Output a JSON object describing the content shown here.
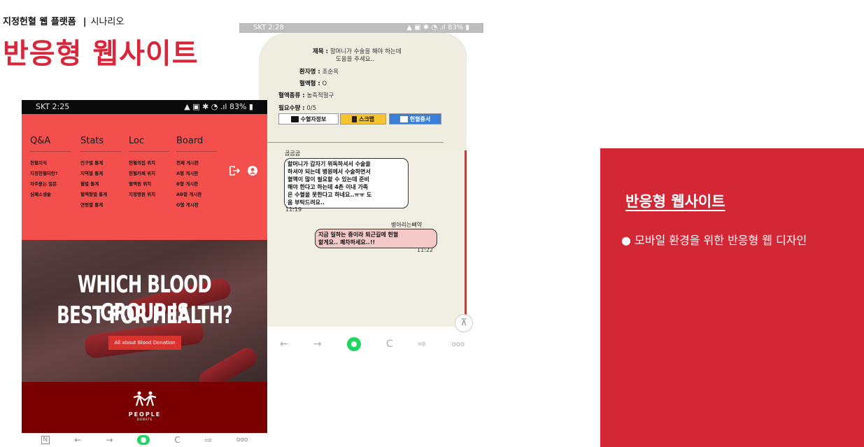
{
  "slide": {
    "header_label": "지정헌혈 웹 플랫폼",
    "header_separator": "|",
    "header_sub": "시나리오",
    "title": "반응형 웹사이트"
  },
  "phone1": {
    "status_time": "SKT 2:25",
    "status_right": "83%",
    "nav": [
      {
        "head": "Q&A",
        "items": [
          "헌혈지식",
          "지정헌혈이란?",
          "자주묻는 질문",
          "심폐소생술"
        ]
      },
      {
        "head": "Stats",
        "items": [
          "인구별 통계",
          "지역별 통계",
          "월별 통계",
          "혈액형별 통계",
          "연령별 통계"
        ]
      },
      {
        "head": "Loc",
        "items": [
          "헌혈의집 위치",
          "헌혈카페 위치",
          "혈액원 위치",
          "지정병원 위치"
        ]
      },
      {
        "head": "Board",
        "items": [
          "전체 게시판",
          "A형 게시판",
          "B형 게시판",
          "AB형 게시판",
          "O형 게시판"
        ]
      }
    ],
    "hero_line1": "WHICH BLOOD GROUP IS",
    "hero_line2": "BEST FOR HEALTH?",
    "hero_button": "All about Blood Donation",
    "logo_text": "PEOPLE",
    "logo_sub": "DONATE",
    "bottom_bar": [
      "N",
      "←",
      "→",
      "",
      "C",
      "⇨",
      "ooo"
    ]
  },
  "phone2": {
    "status_time": "SKT 2:28",
    "status_right": "83%",
    "info": {
      "title_key": "제목 :",
      "title_val_1": "할머니가 수술을 해야 하는데",
      "title_val_2": "도움을 주세요..",
      "patient_key": "환자명 :",
      "patient_val": "조순옥",
      "blood_key": "혈액형 :",
      "blood_val": "O",
      "type_key": "혈액종류 :",
      "type_val": "농축적혈구",
      "need_key": "필요수량 :",
      "need_val": "0/5"
    },
    "buttons": {
      "donor_info": "수혈자정보",
      "scrap": "스크랩",
      "certificate": "헌혈증서"
    },
    "comments": [
      {
        "name": "곰곰곰",
        "lines": [
          "할머니가 갑자기 위독하셔서 수술을",
          "하셔야 되는데 병원에서 수술하면서",
          "혈액이 많이 필요할 수 있는데 준비",
          "해야 한다고 하는데 4촌 이내 가족",
          "은 수혈을 못한다고 하네요..ㅠㅠ 도",
          "움 부탁드려요.."
        ],
        "time": "11:19"
      },
      {
        "name": "병아리는삐약",
        "lines": [
          "지금 일하는 중이라 퇴근길에 헌혈",
          "할게요.. 쾌차하세요..!!"
        ],
        "time": "11:22"
      }
    ],
    "top_button": "⊼",
    "bottom_bar": [
      "←",
      "→",
      "",
      "C",
      "⇨",
      "ooo"
    ]
  },
  "panel": {
    "title": "반응형 웹사이트",
    "bullet": "● 모바일 환경을 위한 반응형 웹 디자인"
  },
  "colors": {
    "brand_red": "#d8263a",
    "nav_red": "#f24f4d",
    "panel_red": "#d42736",
    "footer_red": "#7a0000"
  }
}
